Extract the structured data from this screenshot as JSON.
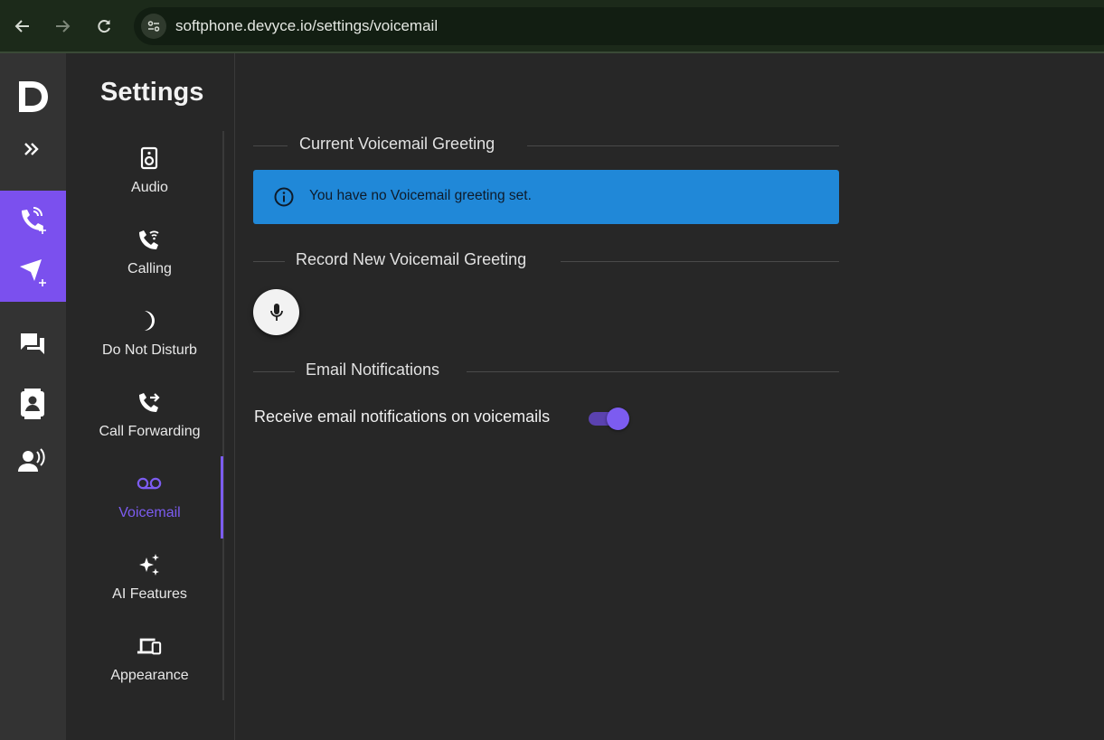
{
  "browser": {
    "url": "softphone.devyce.io/settings/voicemail",
    "back_icon": "arrow-left-icon",
    "forward_icon": "arrow-right-icon",
    "reload_icon": "reload-icon",
    "site_info_icon": "tune-icon"
  },
  "rail": {
    "logo": "D",
    "items": [
      {
        "name": "expand",
        "icon": "double-chevron-right-icon"
      },
      {
        "name": "new-call",
        "icon": "phone-plus-icon"
      },
      {
        "name": "new-message",
        "icon": "send-plus-icon"
      },
      {
        "name": "messages",
        "icon": "chat-icon"
      },
      {
        "name": "contacts",
        "icon": "contact-card-icon"
      },
      {
        "name": "voice-agent",
        "icon": "speaking-person-icon"
      }
    ],
    "accent": "#7b50ee"
  },
  "settings": {
    "title": "Settings",
    "nav": [
      {
        "label": "Audio",
        "icon": "speaker-icon",
        "active": false
      },
      {
        "label": "Calling",
        "icon": "phone-wifi-icon",
        "active": false
      },
      {
        "label": "Do Not Disturb",
        "icon": "moon-icon",
        "active": false
      },
      {
        "label": "Call Forwarding",
        "icon": "phone-forward-icon",
        "active": false
      },
      {
        "label": "Voicemail",
        "icon": "voicemail-icon",
        "active": true
      },
      {
        "label": "AI Features",
        "icon": "sparkles-icon",
        "active": false
      },
      {
        "label": "Appearance",
        "icon": "devices-icon",
        "active": false
      }
    ]
  },
  "main": {
    "current_greeting_title": "Current Voicemail Greeting",
    "no_greeting_message": "You have no Voicemail greeting set.",
    "record_title": "Record New Voicemail Greeting",
    "mic_icon": "microphone-icon",
    "email_title": "Email Notifications",
    "email_toggle_label": "Receive email notifications on voicemails",
    "email_toggle_on": true
  },
  "colors": {
    "accent": "#7c5cf0",
    "info": "#2088d8",
    "background": "#272727"
  }
}
